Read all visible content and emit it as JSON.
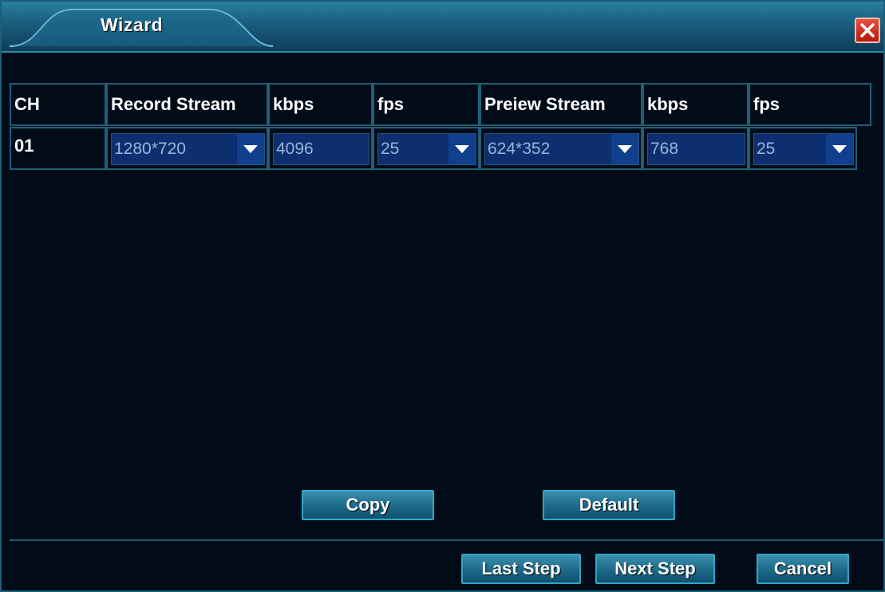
{
  "window": {
    "title": "Wizard"
  },
  "table": {
    "headers": [
      "CH",
      "Record Stream",
      "kbps",
      "fps",
      "Preiew Stream",
      "kbps",
      "fps"
    ],
    "row": {
      "channel": "01",
      "record_stream": "1280*720",
      "record_kbps": "4096",
      "record_fps": "25",
      "preview_stream": "624*352",
      "preview_kbps": "768",
      "preview_fps": "25"
    }
  },
  "buttons": {
    "copy": "Copy",
    "default": "Default",
    "last_step": "Last Step",
    "next_step": "Next Step",
    "cancel": "Cancel"
  },
  "icons": {
    "close": "close-icon",
    "dropdown": "chevron-down-icon"
  },
  "colors": {
    "background": "#020c19",
    "title_bar": "#1a5d7d",
    "field": "#0d2f70",
    "close": "#d8341f"
  }
}
